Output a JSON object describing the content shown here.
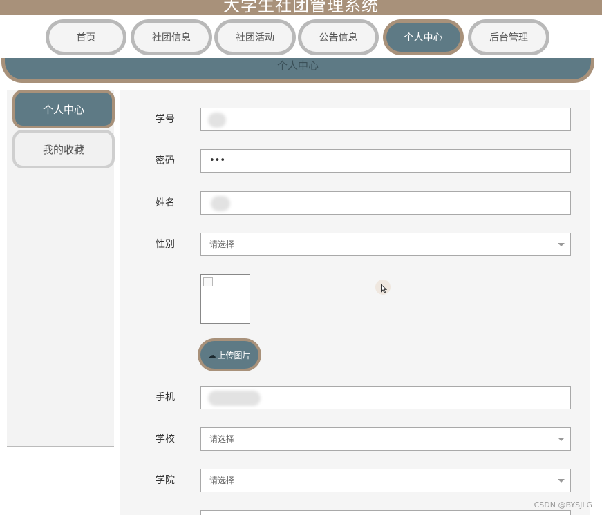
{
  "app": {
    "title": "大学生社团管理系统"
  },
  "nav": {
    "items": [
      {
        "label": "首页"
      },
      {
        "label": "社团信息"
      },
      {
        "label": "社团活动"
      },
      {
        "label": "公告信息"
      },
      {
        "label": "个人中心"
      },
      {
        "label": "后台管理"
      }
    ],
    "active": "个人中心"
  },
  "section": {
    "title": "个人中心"
  },
  "sidebar": {
    "items": [
      {
        "label": "个人中心"
      },
      {
        "label": "我的收藏"
      }
    ],
    "active": "个人中心"
  },
  "form": {
    "student_id": {
      "label": "学号",
      "value": ""
    },
    "password": {
      "label": "密码",
      "value": "•••"
    },
    "name": {
      "label": "姓名",
      "value": ""
    },
    "gender": {
      "label": "性别",
      "placeholder": "请选择"
    },
    "upload": {
      "label": "上传图片"
    },
    "phone": {
      "label": "手机",
      "value": ""
    },
    "school": {
      "label": "学校",
      "placeholder": "请选择"
    },
    "college": {
      "label": "学院",
      "placeholder": "请选择"
    }
  },
  "watermark": "CSDN @BYSJLG",
  "colors": {
    "accent_brown": "#a8917a",
    "accent_slate": "#5e7a85"
  }
}
